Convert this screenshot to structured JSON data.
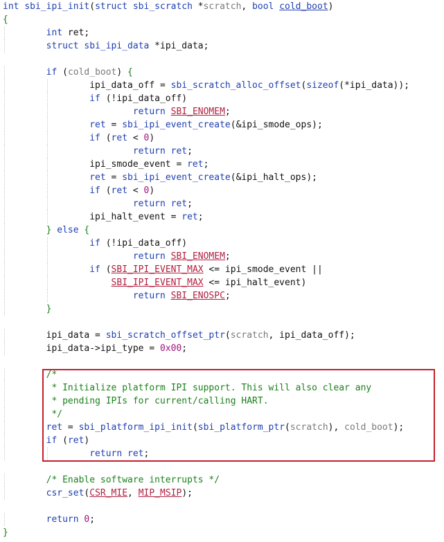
{
  "editor": {
    "highlight_color": "#c41e2a",
    "lines": [
      [
        [
          "kw",
          "int"
        ],
        [
          "pl",
          " "
        ],
        [
          "fn",
          "sbi_ipi_init"
        ],
        [
          "pl",
          "("
        ],
        [
          "ty",
          "struct"
        ],
        [
          "pl",
          " "
        ],
        [
          "fn",
          "sbi_scratch"
        ],
        [
          "pl",
          " *"
        ],
        [
          "dim",
          "scratch"
        ],
        [
          "pl",
          ", "
        ],
        [
          "ty",
          "bool"
        ],
        [
          "pl",
          " "
        ],
        [
          "fnul",
          "cold_boot"
        ],
        [
          "pl",
          ")"
        ]
      ],
      [
        [
          "br",
          "{"
        ]
      ],
      [
        [
          "pl",
          "        "
        ],
        [
          "ty",
          "int"
        ],
        [
          "pl",
          " ret;"
        ]
      ],
      [
        [
          "pl",
          "        "
        ],
        [
          "ty",
          "struct"
        ],
        [
          "pl",
          " "
        ],
        [
          "fn",
          "sbi_ipi_data"
        ],
        [
          "pl",
          " *ipi_data;"
        ]
      ],
      [
        [
          "pl",
          ""
        ]
      ],
      [
        [
          "pl",
          "        "
        ],
        [
          "kw",
          "if"
        ],
        [
          "pl",
          " ("
        ],
        [
          "dim",
          "cold_boot"
        ],
        [
          "pl",
          ") "
        ],
        [
          "br",
          "{"
        ]
      ],
      [
        [
          "pl",
          "                ipi_data_off = "
        ],
        [
          "fn",
          "sbi_scratch_alloc_offset"
        ],
        [
          "pl",
          "("
        ],
        [
          "kw",
          "sizeof"
        ],
        [
          "pl",
          "(*ipi_data));"
        ]
      ],
      [
        [
          "pl",
          "                "
        ],
        [
          "kw",
          "if"
        ],
        [
          "pl",
          " (!ipi_data_off)"
        ]
      ],
      [
        [
          "pl",
          "                        "
        ],
        [
          "kw",
          "return"
        ],
        [
          "pl",
          " "
        ],
        [
          "mac",
          "SBI_ENOMEM"
        ],
        [
          "pl",
          ";"
        ]
      ],
      [
        [
          "pl",
          "                "
        ],
        [
          "fn",
          "ret"
        ],
        [
          "pl",
          " = "
        ],
        [
          "fn",
          "sbi_ipi_event_create"
        ],
        [
          "pl",
          "(&ipi_smode_ops);"
        ]
      ],
      [
        [
          "pl",
          "                "
        ],
        [
          "kw",
          "if"
        ],
        [
          "pl",
          " ("
        ],
        [
          "fn",
          "ret"
        ],
        [
          "pl",
          " < "
        ],
        [
          "num",
          "0"
        ],
        [
          "pl",
          ")"
        ]
      ],
      [
        [
          "pl",
          "                        "
        ],
        [
          "kw",
          "return"
        ],
        [
          "pl",
          " "
        ],
        [
          "fn",
          "ret"
        ],
        [
          "pl",
          ";"
        ]
      ],
      [
        [
          "pl",
          "                ipi_smode_event = "
        ],
        [
          "fn",
          "ret"
        ],
        [
          "pl",
          ";"
        ]
      ],
      [
        [
          "pl",
          "                "
        ],
        [
          "fn",
          "ret"
        ],
        [
          "pl",
          " = "
        ],
        [
          "fn",
          "sbi_ipi_event_create"
        ],
        [
          "pl",
          "(&ipi_halt_ops);"
        ]
      ],
      [
        [
          "pl",
          "                "
        ],
        [
          "kw",
          "if"
        ],
        [
          "pl",
          " ("
        ],
        [
          "fn",
          "ret"
        ],
        [
          "pl",
          " < "
        ],
        [
          "num",
          "0"
        ],
        [
          "pl",
          ")"
        ]
      ],
      [
        [
          "pl",
          "                        "
        ],
        [
          "kw",
          "return"
        ],
        [
          "pl",
          " "
        ],
        [
          "fn",
          "ret"
        ],
        [
          "pl",
          ";"
        ]
      ],
      [
        [
          "pl",
          "                ipi_halt_event = "
        ],
        [
          "fn",
          "ret"
        ],
        [
          "pl",
          ";"
        ]
      ],
      [
        [
          "pl",
          "        "
        ],
        [
          "br",
          "}"
        ],
        [
          "pl",
          " "
        ],
        [
          "kw",
          "else"
        ],
        [
          "pl",
          " "
        ],
        [
          "br",
          "{"
        ]
      ],
      [
        [
          "pl",
          "                "
        ],
        [
          "kw",
          "if"
        ],
        [
          "pl",
          " (!ipi_data_off)"
        ]
      ],
      [
        [
          "pl",
          "                        "
        ],
        [
          "kw",
          "return"
        ],
        [
          "pl",
          " "
        ],
        [
          "mac",
          "SBI_ENOMEM"
        ],
        [
          "pl",
          ";"
        ]
      ],
      [
        [
          "pl",
          "                "
        ],
        [
          "kw",
          "if"
        ],
        [
          "pl",
          " ("
        ],
        [
          "mac",
          "SBI_IPI_EVENT_MAX"
        ],
        [
          "pl",
          " <= ipi_smode_event ||"
        ]
      ],
      [
        [
          "pl",
          "                    "
        ],
        [
          "mac",
          "SBI_IPI_EVENT_MAX"
        ],
        [
          "pl",
          " <= ipi_halt_event)"
        ]
      ],
      [
        [
          "pl",
          "                        "
        ],
        [
          "kw",
          "return"
        ],
        [
          "pl",
          " "
        ],
        [
          "mac",
          "SBI_ENOSPC"
        ],
        [
          "pl",
          ";"
        ]
      ],
      [
        [
          "pl",
          "        "
        ],
        [
          "br",
          "}"
        ]
      ],
      [
        [
          "pl",
          ""
        ]
      ],
      [
        [
          "pl",
          "        ipi_data = "
        ],
        [
          "fn",
          "sbi_scratch_offset_ptr"
        ],
        [
          "pl",
          "("
        ],
        [
          "dim",
          "scratch"
        ],
        [
          "pl",
          ", ipi_data_off);"
        ]
      ],
      [
        [
          "pl",
          "        ipi_data->ipi_type = "
        ],
        [
          "num",
          "0x00"
        ],
        [
          "pl",
          ";"
        ]
      ],
      [
        [
          "pl",
          ""
        ]
      ],
      [
        [
          "pl",
          "        "
        ],
        [
          "cm",
          "/*"
        ]
      ],
      [
        [
          "pl",
          "        "
        ],
        [
          "cm",
          " * Initialize platform IPI support. This will also clear any"
        ]
      ],
      [
        [
          "pl",
          "        "
        ],
        [
          "cm",
          " * pending IPIs for current/calling HART."
        ]
      ],
      [
        [
          "pl",
          "        "
        ],
        [
          "cm",
          " */"
        ]
      ],
      [
        [
          "pl",
          "        "
        ],
        [
          "fn",
          "ret"
        ],
        [
          "pl",
          " = "
        ],
        [
          "fn",
          "sbi_platform_ipi_init"
        ],
        [
          "pl",
          "("
        ],
        [
          "fn",
          "sbi_platform_ptr"
        ],
        [
          "pl",
          "("
        ],
        [
          "dim",
          "scratch"
        ],
        [
          "pl",
          "), "
        ],
        [
          "dim",
          "cold_boot"
        ],
        [
          "pl",
          ");"
        ]
      ],
      [
        [
          "pl",
          "        "
        ],
        [
          "kw",
          "if"
        ],
        [
          "pl",
          " ("
        ],
        [
          "fn",
          "ret"
        ],
        [
          "pl",
          ")"
        ]
      ],
      [
        [
          "pl",
          "                "
        ],
        [
          "kw",
          "return"
        ],
        [
          "pl",
          " "
        ],
        [
          "fn",
          "ret"
        ],
        [
          "pl",
          ";"
        ]
      ],
      [
        [
          "pl",
          ""
        ]
      ],
      [
        [
          "pl",
          "        "
        ],
        [
          "cm",
          "/* Enable software interrupts */"
        ]
      ],
      [
        [
          "pl",
          "        "
        ],
        [
          "fn",
          "csr_set"
        ],
        [
          "pl",
          "("
        ],
        [
          "mac",
          "CSR_MIE"
        ],
        [
          "pl",
          ", "
        ],
        [
          "mac",
          "MIP_MSIP"
        ],
        [
          "pl",
          ");"
        ]
      ],
      [
        [
          "pl",
          ""
        ]
      ],
      [
        [
          "pl",
          "        "
        ],
        [
          "kw",
          "return"
        ],
        [
          "pl",
          " "
        ],
        [
          "num",
          "0"
        ],
        [
          "pl",
          ";"
        ]
      ],
      [
        [
          "br",
          "}"
        ]
      ]
    ]
  }
}
